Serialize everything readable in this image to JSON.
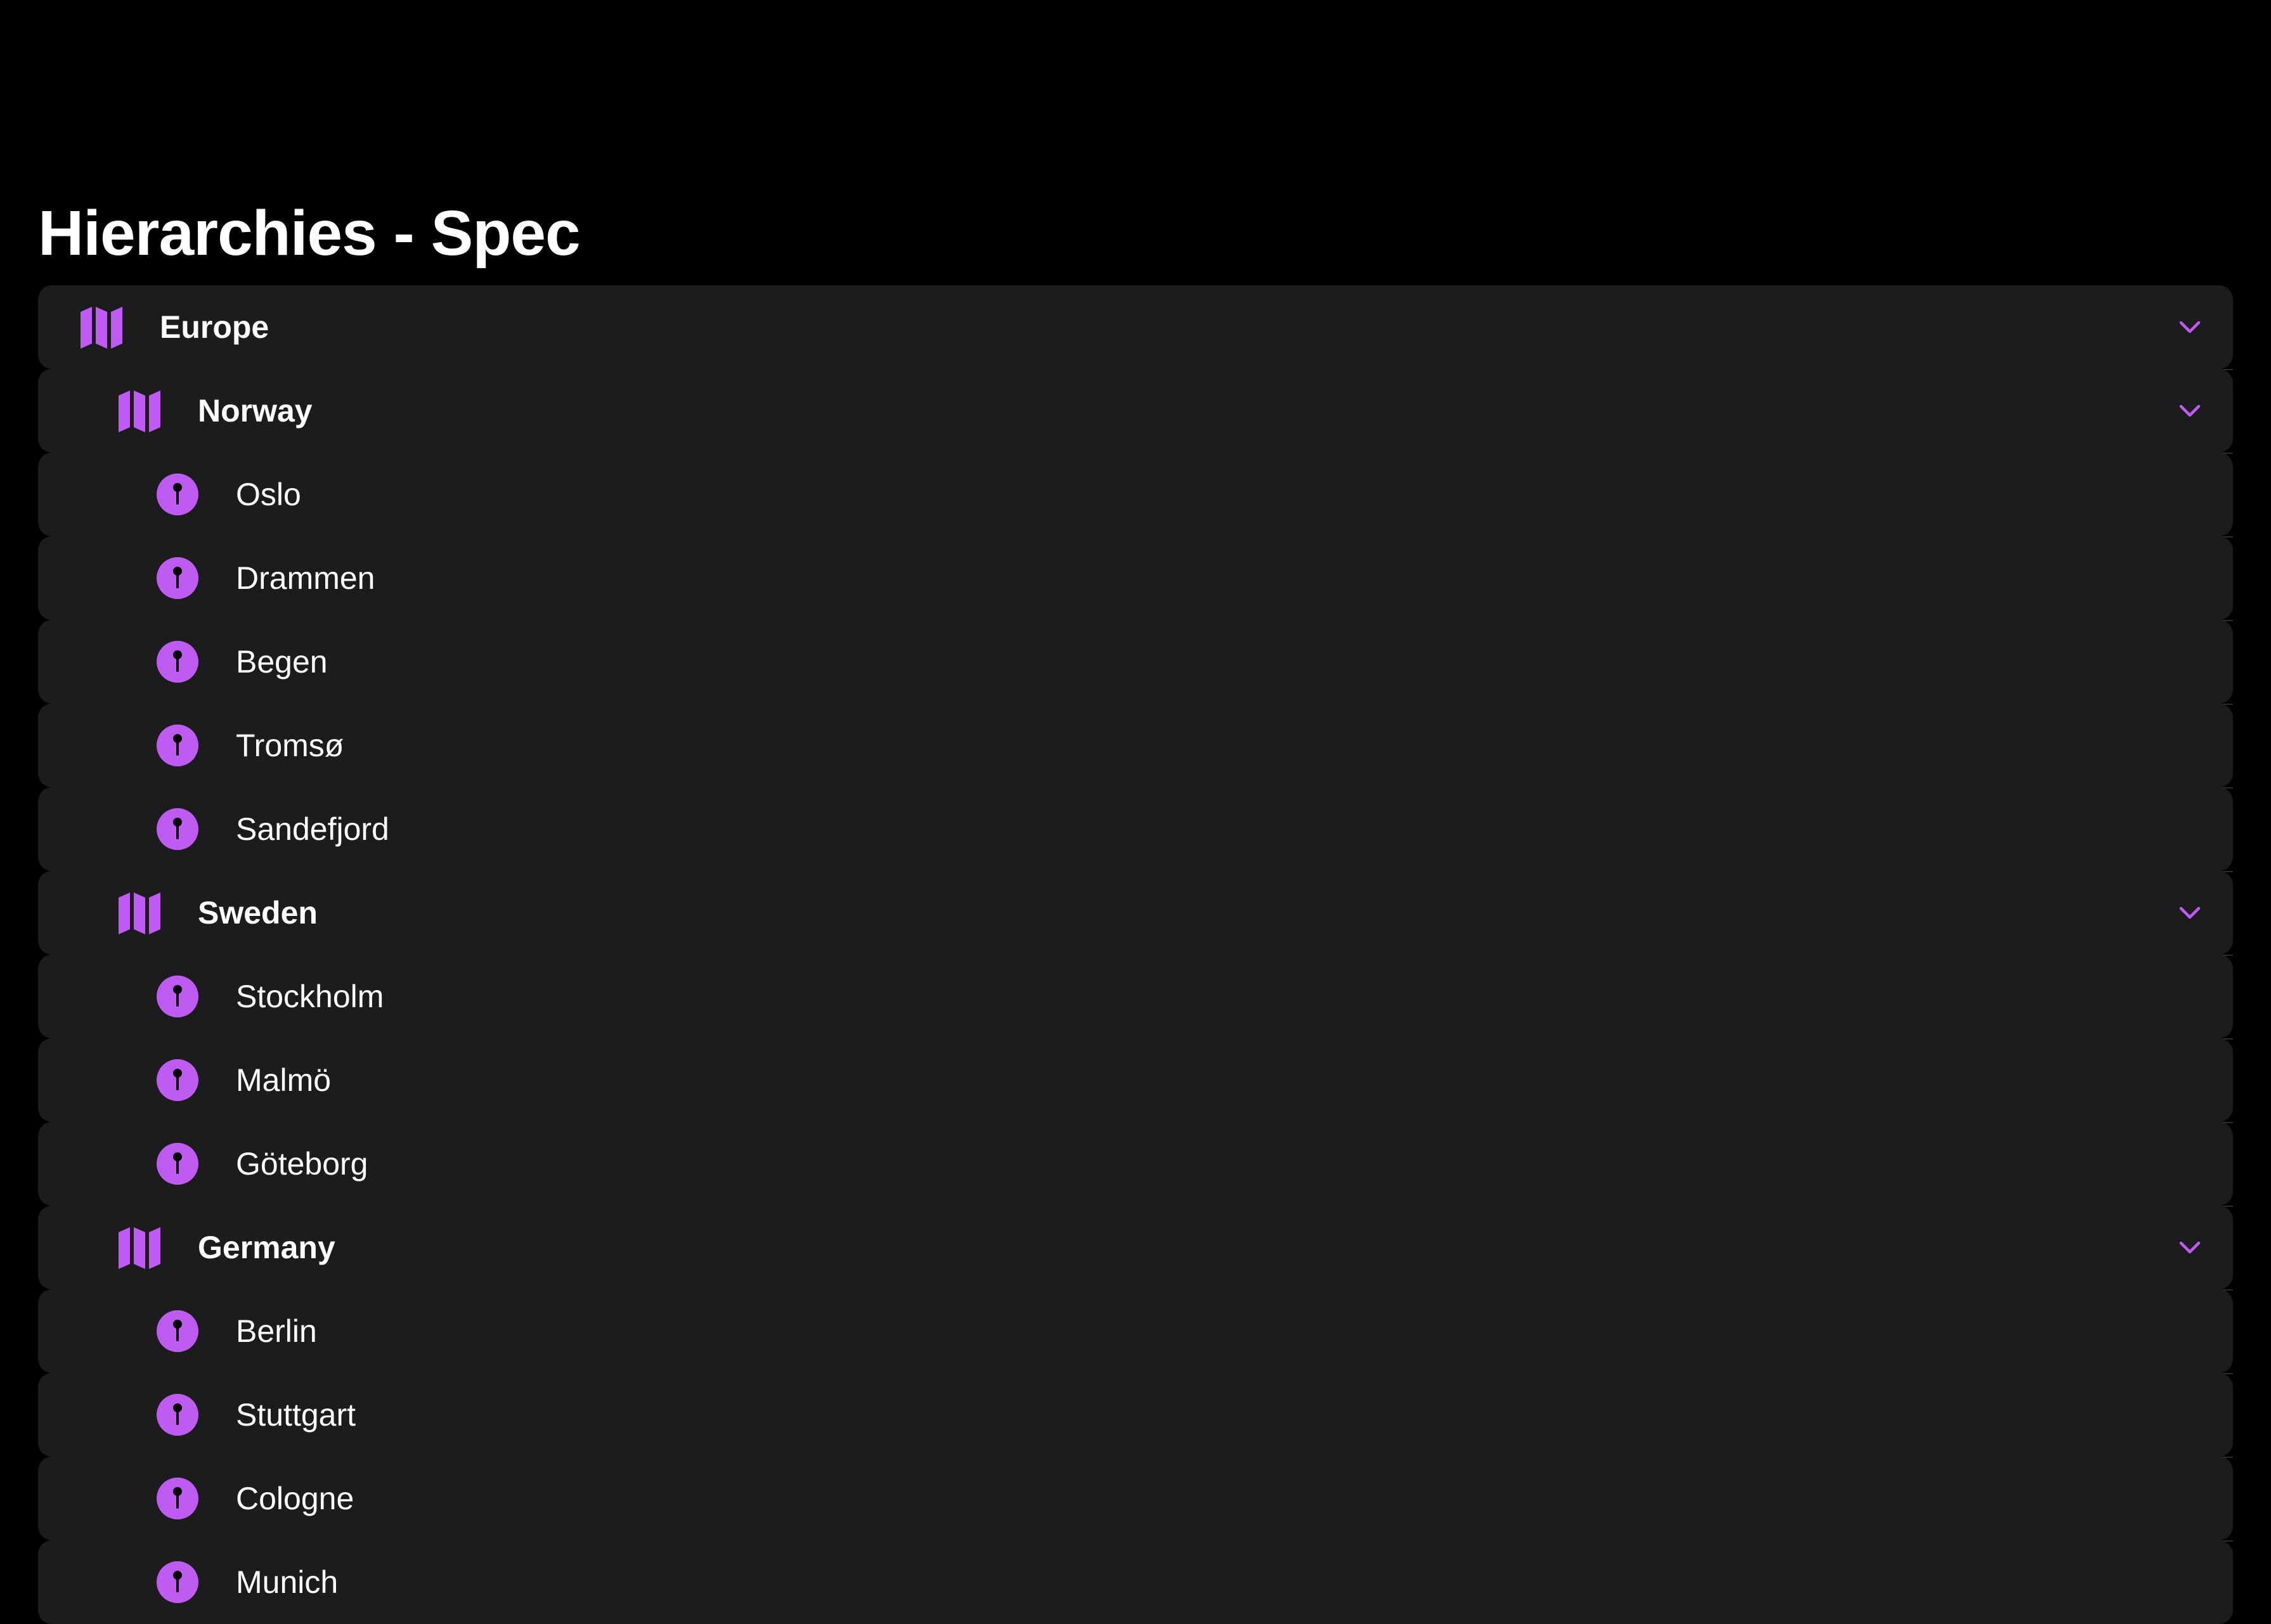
{
  "title": "Hierarchies - Spec",
  "accent": "#bf5af2",
  "tree": {
    "label": "Europe",
    "icon": "map-icon",
    "expanded": true,
    "countries": [
      {
        "label": "Norway",
        "icon": "map-icon",
        "expanded": true,
        "cities": [
          "Oslo",
          "Drammen",
          "Begen",
          "Tromsø",
          "Sandefjord"
        ]
      },
      {
        "label": "Sweden",
        "icon": "map-icon",
        "expanded": true,
        "cities": [
          "Stockholm",
          "Malmö",
          "Göteborg"
        ]
      },
      {
        "label": "Germany",
        "icon": "map-icon",
        "expanded": true,
        "cities": [
          "Berlin",
          "Stuttgart",
          "Cologne",
          "Munich"
        ]
      }
    ]
  }
}
